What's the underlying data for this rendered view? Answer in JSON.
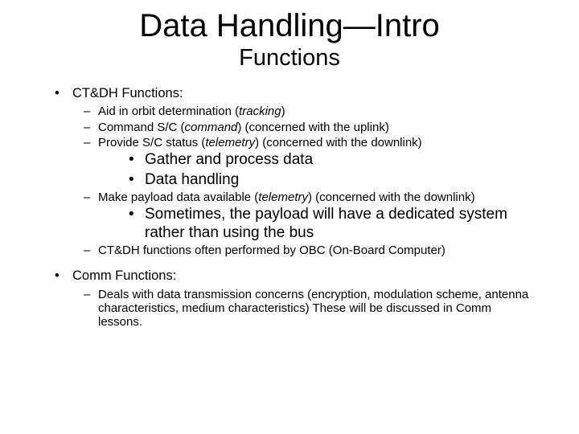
{
  "title": "Data Handling—Intro",
  "subtitle": "Functions",
  "sec1": {
    "heading": "CT&DH Functions:",
    "a": "Aid in orbit determination (",
    "a_ital": "tracking",
    "a_end": ")",
    "b": "Command S/C (",
    "b_ital": "command",
    "b_end": ") (concerned with the uplink)",
    "c": "Provide S/C status (",
    "c_ital": "telemetry",
    "c_end": ") (concerned with the downlink)",
    "c1": "Gather and process data",
    "c2": "Data handling",
    "d": "Make payload data available (",
    "d_ital": "telemetry",
    "d_end": ") (concerned with the downlink)",
    "d1": "Sometimes, the payload will have a dedicated system rather than using the bus",
    "e": "CT&DH functions often performed by OBC (On-Board Computer)"
  },
  "sec2": {
    "heading": "Comm Functions:",
    "a": "Deals with data transmission concerns (encryption, modulation scheme, antenna characteristics, medium characteristics)  These will be discussed in Comm lessons."
  }
}
